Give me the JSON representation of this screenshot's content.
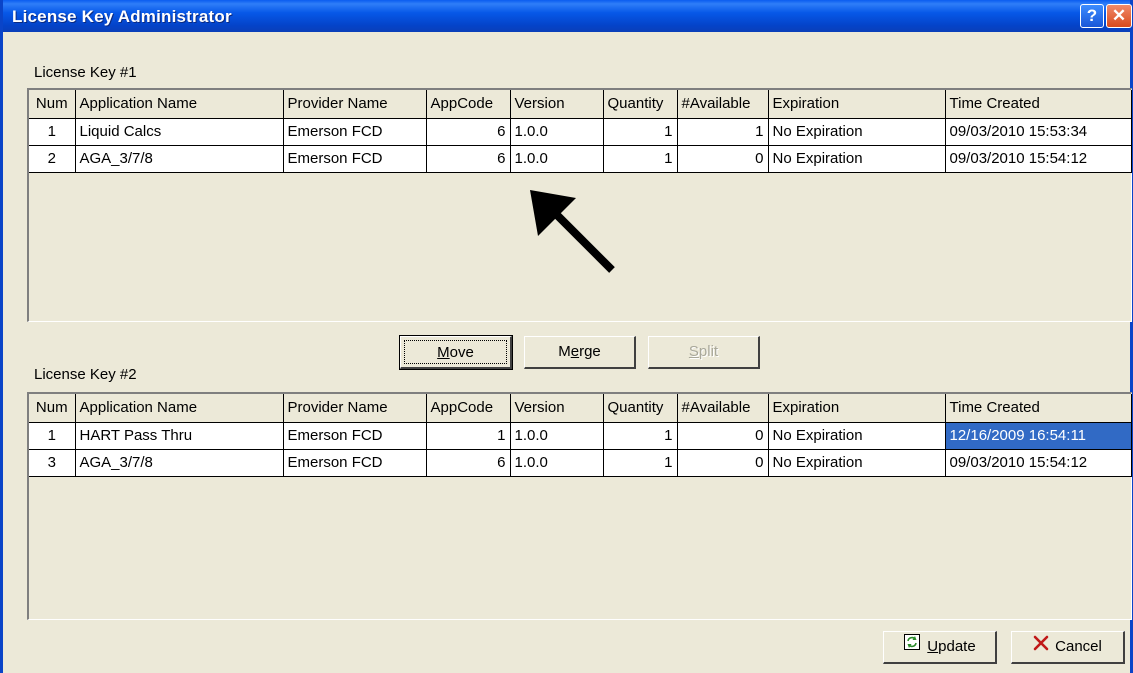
{
  "window": {
    "title": "License Key Administrator",
    "help": "?",
    "close": "✕"
  },
  "columns": [
    "Num",
    "Application Name",
    "Provider Name",
    "AppCode",
    "Version",
    "Quantity",
    "#Available",
    "Expiration",
    "Time Created"
  ],
  "key1": {
    "label": "License Key #1",
    "rows": [
      {
        "num": "1",
        "app": "Liquid Calcs",
        "provider": "Emerson FCD",
        "appcode": "6",
        "version": "1.0.0",
        "quantity": "1",
        "available": "1",
        "expiration": "No Expiration",
        "created": "09/03/2010 15:53:34"
      },
      {
        "num": "2",
        "app": "AGA_3/7/8",
        "provider": "Emerson FCD",
        "appcode": "6",
        "version": "1.0.0",
        "quantity": "1",
        "available": "0",
        "expiration": "No Expiration",
        "created": "09/03/2010 15:54:12"
      }
    ]
  },
  "key2": {
    "label": "License Key #2",
    "rows": [
      {
        "num": "1",
        "app": "HART Pass Thru",
        "provider": "Emerson FCD",
        "appcode": "1",
        "version": "1.0.0",
        "quantity": "1",
        "available": "0",
        "expiration": "No Expiration",
        "created": "12/16/2009 16:54:11"
      },
      {
        "num": "3",
        "app": "AGA_3/7/8",
        "provider": "Emerson FCD",
        "appcode": "6",
        "version": "1.0.0",
        "quantity": "1",
        "available": "0",
        "expiration": "No Expiration",
        "created": "09/03/2010 15:54:12"
      }
    ]
  },
  "buttons": {
    "move_mnemonic": "M",
    "move_rest": "ove",
    "merge_pre": "M",
    "merge_mnemonic": "e",
    "merge_rest": "rge",
    "split_mnemonic": "S",
    "split_rest": "plit",
    "update_mnemonic": "U",
    "update_rest": "pdate",
    "cancel": "Cancel"
  },
  "colors": {
    "title_blue": "#0a5cf0",
    "dialog_bg": "#ece9d8",
    "selection": "#316ac5"
  },
  "icons": {
    "update": "refresh-icon",
    "cancel": "x-icon",
    "annotation": "arrow-icon"
  }
}
